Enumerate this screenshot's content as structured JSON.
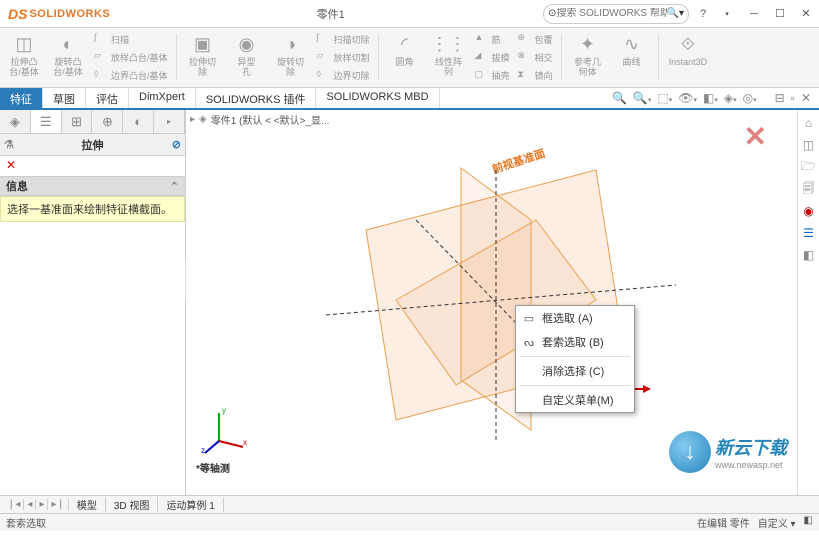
{
  "app": {
    "name": "SOLIDWORKS",
    "doc_title": "零件1"
  },
  "search": {
    "placeholder": "搜索 SOLIDWORKS 帮助"
  },
  "ribbon": {
    "extrude": {
      "l1": "拉伸凸",
      "l2": "台/基体"
    },
    "revolve": {
      "l1": "旋转凸",
      "l2": "台/基体"
    },
    "sweep": "扫描",
    "loft": "放样凸台/基体",
    "boundary": "边界凸台/基体",
    "extcut": {
      "l1": "拉伸切",
      "l2": "除"
    },
    "wizard": {
      "l1": "异型",
      "l2": "孔"
    },
    "revcut": {
      "l1": "旋转切",
      "l2": "除"
    },
    "sweepcut": "扫描切除",
    "loftcut": "放样切割",
    "boundcut": "边界切除",
    "fillet": "圆角",
    "pattern": {
      "l1": "线性阵",
      "l2": "列"
    },
    "rib": "筋",
    "draft": "拔模",
    "shell": "抽壳",
    "wrap": "包覆",
    "intersect": "相交",
    "mirror": "镜向",
    "refgeom": {
      "l1": "参考几",
      "l2": "何体"
    },
    "curves": "曲线",
    "instant3d": "Instant3D"
  },
  "tabs": {
    "t1": "特征",
    "t2": "草图",
    "t3": "评估",
    "t4": "DimXpert",
    "t5": "SOLIDWORKS 插件",
    "t6": "SOLIDWORKS MBD"
  },
  "panel": {
    "title": "拉伸",
    "section": "信息",
    "hint": "选择一基准面来绘制特征横截面。"
  },
  "breadcrumb": {
    "text": "零件1  (默认 < <默认>_显..."
  },
  "plane": {
    "front": "前视基准面"
  },
  "context_menu": {
    "m1": "框选取 (A)",
    "m2": "套索选取 (B)",
    "m3": "消除选择 (C)",
    "m4": "自定义菜单(M)"
  },
  "triad": {
    "x": "x",
    "y": "y",
    "z": "z",
    "view": "*等轴测"
  },
  "bottom_tabs": {
    "b1": "模型",
    "b2": "3D 视图",
    "b3": "运动算例 1"
  },
  "status": {
    "left": "套索选取",
    "edit": "在编辑 零件",
    "custom": "自定义"
  },
  "watermark": {
    "cn": "新云下载",
    "en": "www.newasp.net"
  }
}
